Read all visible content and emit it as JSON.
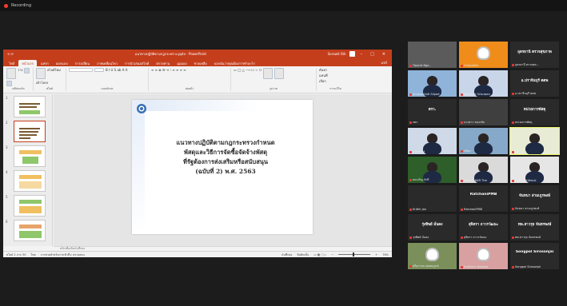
{
  "recording": {
    "label": "Recording"
  },
  "ppt": {
    "quick_access": "⟲ ⟳",
    "title": "แนวทางปฏิบัติตามกฎกระทรวง.pptx - PowerPoint",
    "user": "Sorawit Sth",
    "tabs": [
      "ไฟล์",
      "หน้าแรก",
      "แทรก",
      "ออกแบบ",
      "การเปลี่ยน",
      "ภาพเคลื่อนไหว",
      "การนำเสนอสไลด์",
      "ตรวจทาน",
      "มุมมอง",
      "ช่วยเหลือ",
      "บอกฉันว่าคุณต้องการทำอะไร"
    ],
    "share": "แชร์",
    "ribbon_groups": [
      "คลิปบอร์ด",
      "สไลด์",
      "แบบอักษร",
      "ย่อหน้า",
      "รูปวาด",
      "การแก้ไข"
    ],
    "ribbon_texts": [
      "วาง",
      "สไลด์ใหม่",
      "เค้าโครง",
      "ค้นหา",
      "แทนที่",
      "เลือก"
    ],
    "slide_numbers": [
      "1",
      "2",
      "3",
      "4",
      "5",
      "6"
    ],
    "slide_title_lines": [
      "แนวทางปฏิบัติตามกฎกระทรวงกำหนด",
      "พัสดุและวิธีการจัดซื้อจัดจ้างพัสดุ",
      "ที่รัฐต้องการส่งเสริมหรือสนับสนุน",
      "(ฉบับที่ 2) พ.ศ. 2563"
    ],
    "notes_placeholder": "คลิกเพื่อเพิ่มบันทึกย่อ",
    "status": {
      "slide_info": "สไลด์ 2 จาก 30",
      "language": "ไทย",
      "accessibility": "การช่วยสำหรับการเข้าถึง: ตรวจสอบ",
      "notes": "บันทึกย่อ",
      "comments": "ข้อคิดเห็น",
      "zoom": "76%"
    }
  },
  "participants": [
    {
      "name": "",
      "caption": "Tiparat Ngo..",
      "color": "#5b5b5b",
      "kind": "blank"
    },
    {
      "name": "",
      "caption": "ChaiyaNet",
      "color": "#f08c1a",
      "kind": "logo"
    },
    {
      "name": "อุดรธานี ตรวจสุขภาพ",
      "caption": "อุดรธานี ตรวจสุข...",
      "color": "#2a2a2a",
      "kind": "text"
    },
    {
      "name": "",
      "caption": "Anusornthiti Silpart",
      "color": "#8fb3d9",
      "kind": "person"
    },
    {
      "name": "",
      "caption": "Kanyarat Srisuwan",
      "color": "#c9d6ea",
      "kind": "person"
    },
    {
      "name": "อ.ปราจีนบุรี ตตพ",
      "caption": "อ.ปราจีนบุรี ตตพ",
      "color": "#2a2a2a",
      "kind": "text"
    },
    {
      "name": "ตรว.",
      "caption": "จตร",
      "color": "#2a2a2a",
      "kind": "text"
    },
    {
      "name": "",
      "caption": "นางสาว รอบกลับ",
      "color": "#3f3f3f",
      "kind": "blank"
    },
    {
      "name": "หน่วยการพัสดุ",
      "caption": "หน่วยการพัสดุ",
      "color": "#2a2a2a",
      "kind": "text"
    },
    {
      "name": "",
      "caption": "Sureerat",
      "color": "#cfd9e8",
      "kind": "person"
    },
    {
      "name": "",
      "caption": "ชนิดา",
      "color": "#87a9c9",
      "kind": "person"
    },
    {
      "name": "",
      "caption": "Piyanart",
      "color": "#e9ecd5",
      "kind": "person"
    },
    {
      "name": "",
      "caption": "สมเจริญ ภักดี",
      "color": "#2e5e2a",
      "kind": "person"
    },
    {
      "name": "",
      "caption": "Manida NKR Ttm",
      "color": "#dadada",
      "kind": "person"
    },
    {
      "name": "",
      "caption": "Manisa Kittisuk",
      "color": "#e6e6e6",
      "kind": "person"
    },
    {
      "name": "",
      "caption": "Krittin Jan",
      "color": "#2a2a2a",
      "kind": "blank"
    },
    {
      "name": "RatchaniPMB",
      "caption": "RatchaniPMB",
      "color": "#2a2a2a",
      "kind": "text"
    },
    {
      "name": "จันทนา สามเกูรพงษ์",
      "caption": "จันทนา สามเกูรพงษ์",
      "color": "#2a2a2a",
      "kind": "text"
    },
    {
      "name": "รุ่งทิพย์ มั่นคง",
      "caption": "รุ่งทิพย์ มั่นคง",
      "color": "#2a2a2a",
      "kind": "text"
    },
    {
      "name": "สุจิตรา ถาวรวัฒนะ",
      "caption": "สุจิตรา ถาวรวัฒนะ",
      "color": "#2a2a2a",
      "kind": "text"
    },
    {
      "name": "ทพ.สาวรุธ จันทรพงษ์",
      "caption": "ทพ.สาวรุธ จันทรพงษ์",
      "color": "#2a2a2a",
      "kind": "text"
    },
    {
      "name": "",
      "caption": "ศรีสุวรรณ สุขสมบูรณ์",
      "color": "#7a8f5a",
      "kind": "logo"
    },
    {
      "name": "",
      "caption": "Nuttakrn Wirawat",
      "color": "#d8a0a0",
      "kind": "logo"
    },
    {
      "name": "Songpol Sirosonjai",
      "caption": "Songpol Sirosonjai",
      "color": "#2a2a2a",
      "kind": "text"
    }
  ]
}
